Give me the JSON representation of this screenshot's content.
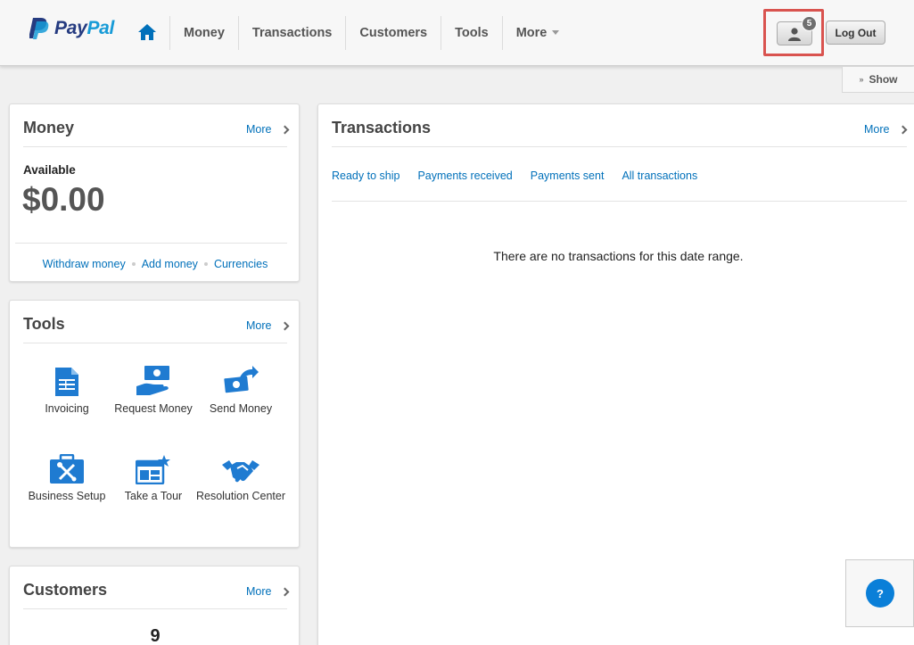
{
  "brand": {
    "pay": "Pay",
    "pal": "Pal"
  },
  "nav": {
    "items": [
      {
        "label": "Money"
      },
      {
        "label": "Transactions"
      },
      {
        "label": "Customers"
      },
      {
        "label": "Tools"
      },
      {
        "label": "More"
      }
    ]
  },
  "header": {
    "notification_count": "5",
    "logout_label": "Log Out",
    "show_label": "Show"
  },
  "money": {
    "title": "Money",
    "more_label": "More",
    "available_label": "Available",
    "balance": "$0.00",
    "links": [
      "Withdraw money",
      "Add money",
      "Currencies"
    ]
  },
  "tools": {
    "title": "Tools",
    "more_label": "More",
    "items": [
      {
        "label": "Invoicing",
        "icon": "invoice-icon"
      },
      {
        "label": "Request Money",
        "icon": "request-money-icon"
      },
      {
        "label": "Send Money",
        "icon": "send-money-icon"
      },
      {
        "label": "Business Setup",
        "icon": "business-setup-icon"
      },
      {
        "label": "Take a Tour",
        "icon": "tour-icon"
      },
      {
        "label": "Resolution Center",
        "icon": "handshake-icon"
      }
    ]
  },
  "customers": {
    "title": "Customers",
    "more_label": "More",
    "count": "9"
  },
  "transactions": {
    "title": "Transactions",
    "more_label": "More",
    "tabs": [
      "Ready to ship",
      "Payments received",
      "Payments sent",
      "All transactions"
    ],
    "empty_message": "There are no transactions for this date range."
  },
  "help": {
    "label": "?"
  },
  "colors": {
    "link": "#0070ba",
    "icon_blue": "#1f7bd1",
    "highlight": "#d9534f",
    "brand_dark": "#253b80",
    "brand_light": "#179bd7"
  }
}
